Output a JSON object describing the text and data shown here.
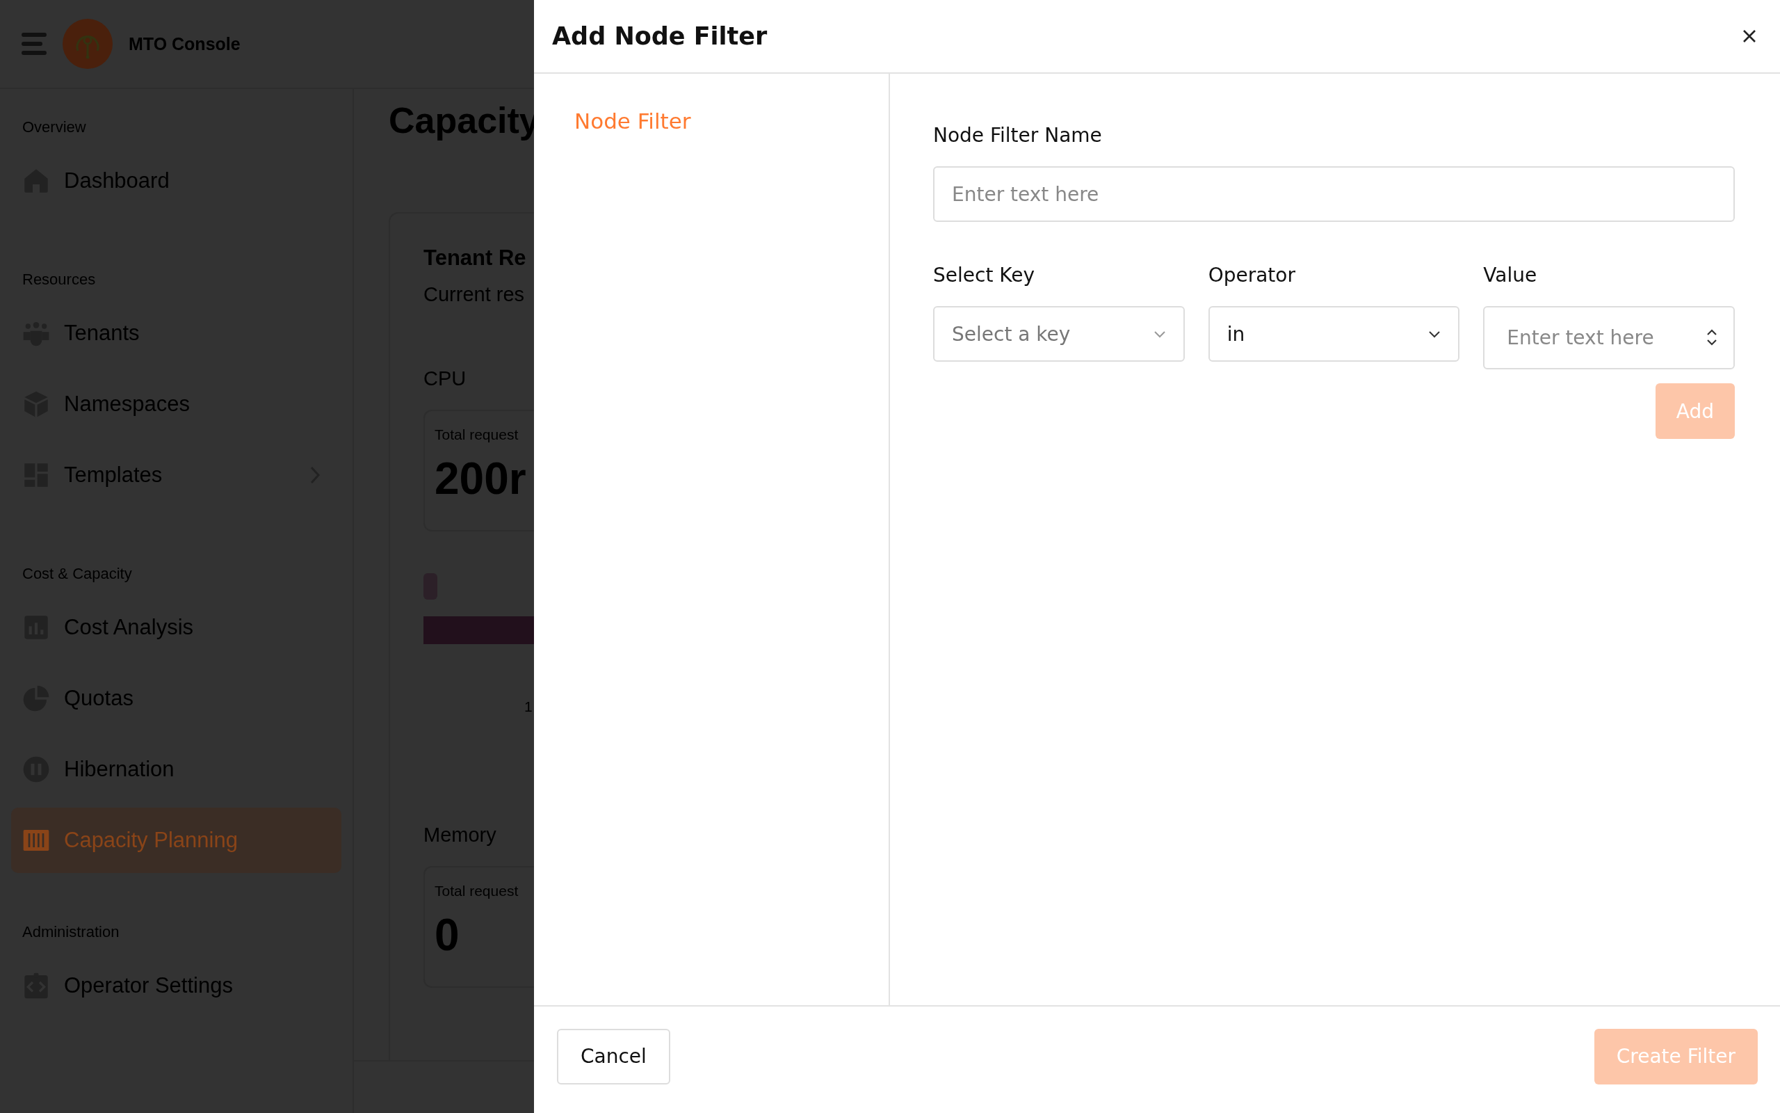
{
  "app": {
    "title": "MTO Console"
  },
  "sidebar": {
    "sections": [
      {
        "heading": "Overview",
        "items": [
          {
            "label": "Dashboard",
            "selected": false,
            "has_submenu": false
          }
        ]
      },
      {
        "heading": "Resources",
        "items": [
          {
            "label": "Tenants",
            "selected": false,
            "has_submenu": false
          },
          {
            "label": "Namespaces",
            "selected": false,
            "has_submenu": false
          },
          {
            "label": "Templates",
            "selected": false,
            "has_submenu": true
          }
        ]
      },
      {
        "heading": "Cost & Capacity",
        "items": [
          {
            "label": "Cost Analysis",
            "selected": false,
            "has_submenu": false
          },
          {
            "label": "Quotas",
            "selected": false,
            "has_submenu": false
          },
          {
            "label": "Hibernation",
            "selected": false,
            "has_submenu": false
          },
          {
            "label": "Capacity Planning",
            "selected": true,
            "has_submenu": false
          }
        ]
      },
      {
        "heading": "Administration",
        "items": [
          {
            "label": "Operator Settings",
            "selected": false,
            "has_submenu": false
          }
        ]
      }
    ]
  },
  "main": {
    "title": "Capacity",
    "card": {
      "title": "Tenant Re",
      "subtitle": "Current res",
      "sections": [
        {
          "heading": "CPU",
          "stat_label": "Total request",
          "stat_value": "200r",
          "axis_label": "1"
        },
        {
          "heading": "Memory",
          "stat_label": "Total request",
          "stat_value": "0"
        }
      ]
    }
  },
  "modal": {
    "title": "Add Node Filter",
    "nav": [
      {
        "label": "Node Filter",
        "selected": true
      }
    ],
    "form": {
      "name_field": {
        "label": "Node Filter Name",
        "placeholder": "Enter text here"
      },
      "key": {
        "label": "Select Key",
        "placeholder": "Select a key"
      },
      "operator": {
        "label": "Operator",
        "value": "in"
      },
      "value": {
        "label": "Value",
        "placeholder": "Enter text here"
      },
      "add_button": {
        "label": "Add",
        "disabled": true
      }
    },
    "footer": {
      "cancel": "Cancel",
      "create": {
        "label": "Create Filter",
        "disabled": true
      }
    }
  }
}
